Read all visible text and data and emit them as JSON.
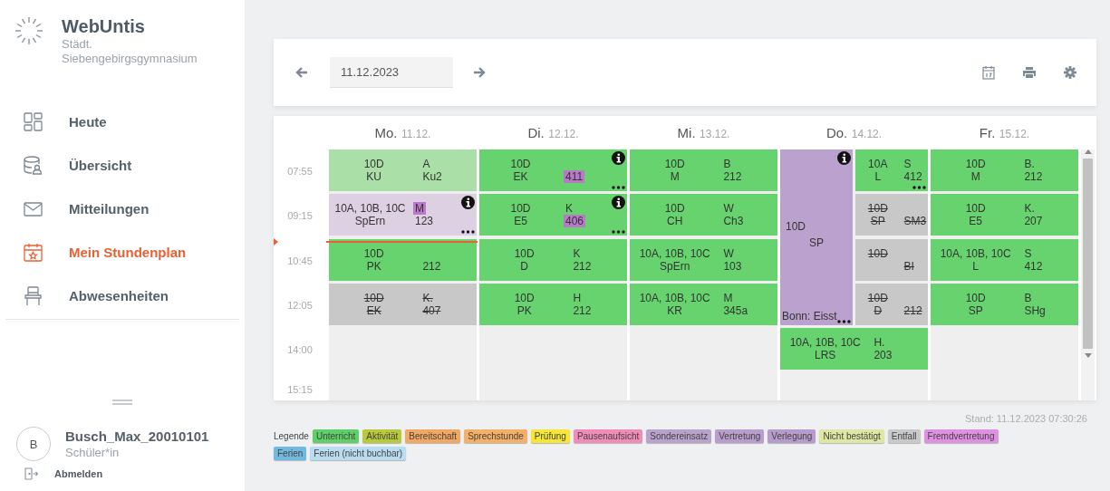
{
  "sidebar": {
    "app_name": "WebUntis",
    "school": "Städt. Siebengebirgsgymnasium",
    "nav": [
      {
        "label": "Heute",
        "kind": "dashboard",
        "selected": false
      },
      {
        "label": "Übersicht",
        "kind": "overview",
        "selected": false
      },
      {
        "label": "Mitteilungen",
        "kind": "messages",
        "selected": false
      },
      {
        "label": "Mein Stundenplan",
        "kind": "timetable",
        "selected": true
      },
      {
        "label": "Abwesenheiten",
        "kind": "absences",
        "selected": false
      }
    ],
    "user": {
      "initial": "B",
      "name": "Busch_Max_20010101",
      "role": "Schüler*in"
    },
    "logout": "Abmelden"
  },
  "toolbar": {
    "date": "11.12.2023"
  },
  "timetable": {
    "times": [
      "07:55",
      "09:15",
      "10:45",
      "12:05",
      "14:00",
      "15:15"
    ],
    "days": [
      {
        "name": "Mo.",
        "date": "11.12.",
        "kind": "plain",
        "slots": [
          {
            "kind": "regular",
            "class": "10D",
            "subject": "KU",
            "teacher": "A",
            "room": "Ku2",
            "past": true
          },
          {
            "kind": "event",
            "class": "10A, 10B, 10C",
            "subject": "SpErn",
            "teacher": "M",
            "room": "123",
            "past": true,
            "teacher_changed": true,
            "info": true,
            "more": true
          },
          {
            "kind": "regular",
            "class": "10D",
            "subject": "PK",
            "room": "212"
          },
          {
            "kind": "cancelled",
            "class": "10D",
            "subject": "EK",
            "teacher": "K.",
            "room": "407"
          },
          {
            "kind": "free"
          },
          {
            "kind": "free"
          }
        ]
      },
      {
        "name": "Di.",
        "date": "12.12.",
        "kind": "plain",
        "slots": [
          {
            "kind": "regular",
            "class": "10D",
            "subject": "EK",
            "room": "411",
            "room_changed": true,
            "info": true,
            "more": true
          },
          {
            "kind": "regular",
            "class": "10D",
            "subject": "E5",
            "teacher": "K",
            "room": "406",
            "room_changed": true,
            "info": true,
            "more": true
          },
          {
            "kind": "regular",
            "class": "10D",
            "subject": "D",
            "teacher": "K",
            "room": "212"
          },
          {
            "kind": "regular",
            "class": "10D",
            "subject": "PK",
            "teacher": "H",
            "room": "212"
          },
          {
            "kind": "free"
          },
          {
            "kind": "free"
          }
        ]
      },
      {
        "name": "Mi.",
        "date": "13.12.",
        "kind": "plain",
        "slots": [
          {
            "kind": "regular",
            "class": "10D",
            "subject": "M",
            "teacher": "B",
            "room": "212"
          },
          {
            "kind": "regular",
            "class": "10D",
            "subject": "CH",
            "teacher": "W",
            "room": "Ch3"
          },
          {
            "kind": "regular",
            "class": "10A, 10B, 10C",
            "subject": "SpErn",
            "teacher": "W",
            "room": "103"
          },
          {
            "kind": "regular",
            "class": "10A, 10B, 10C",
            "subject": "KR",
            "teacher": "M",
            "room": "345a"
          },
          {
            "kind": "free"
          },
          {
            "kind": "free"
          }
        ]
      },
      {
        "name": "Do.",
        "date": "14.12.",
        "kind": "split",
        "block": {
          "kind": "event",
          "class": "10D",
          "subject": "SP",
          "note": "Bonn: Eisst",
          "info": true,
          "more": true
        },
        "beside": [
          {
            "kind": "regular",
            "class": "10A",
            "subject": "L",
            "teacher": "S",
            "room": "412",
            "more": true
          },
          {
            "kind": "cancelled",
            "class": "10D",
            "subject": "SP",
            "room": "SM3"
          },
          {
            "kind": "cancelled",
            "class": "10D",
            "room": "BI"
          },
          {
            "kind": "cancelled",
            "class": "10D",
            "subject": "D",
            "room": "212"
          }
        ],
        "slots": [
          {
            "kind": "regular",
            "class": "10A, 10B, 10C",
            "subject": "LRS",
            "teacher": "H.",
            "room": "203"
          },
          {
            "kind": "free"
          }
        ]
      },
      {
        "name": "Fr.",
        "date": "15.12.",
        "kind": "plain",
        "slots": [
          {
            "kind": "regular",
            "class": "10D",
            "subject": "M",
            "teacher": "B.",
            "room": "212"
          },
          {
            "kind": "regular",
            "class": "10D",
            "subject": "E5",
            "teacher": "K.",
            "room": "207"
          },
          {
            "kind": "regular",
            "class": "10A, 10B, 10C",
            "subject": "L",
            "teacher": "S",
            "room": "412"
          },
          {
            "kind": "regular",
            "class": "10D",
            "subject": "SP",
            "teacher": "B",
            "room": "SHg"
          },
          {
            "kind": "free"
          },
          {
            "kind": "free"
          }
        ]
      }
    ]
  },
  "stand": "Stand: 11.12.2023 07:30:26",
  "legend": {
    "title": "Legende",
    "items": [
      {
        "label": "Unterricht",
        "color": "#5fd068"
      },
      {
        "label": "Aktivität",
        "color": "#b8c93a"
      },
      {
        "label": "Bereitschaft",
        "color": "#f2a862"
      },
      {
        "label": "Sprechstunde",
        "color": "#f4b066"
      },
      {
        "label": "Prüfung",
        "color": "#f7e633"
      },
      {
        "label": "Pausenaufsicht",
        "color": "#f18bb8"
      },
      {
        "label": "Sondereinsatz",
        "color": "#b9a2cb"
      },
      {
        "label": "Vertretung",
        "color": "#b99dcc"
      },
      {
        "label": "Verlegung",
        "color": "#b89bcd"
      },
      {
        "label": "Nicht bestätigt",
        "color": "#dfe7a2"
      },
      {
        "label": "Entfall",
        "color": "#c9c9c9"
      },
      {
        "label": "Fremdvertretung",
        "color": "#e090e2"
      },
      {
        "label": "Ferien",
        "color": "#72b9e2"
      },
      {
        "label": "Ferien (nicht buchbar)",
        "color": "#badcf1"
      }
    ]
  }
}
